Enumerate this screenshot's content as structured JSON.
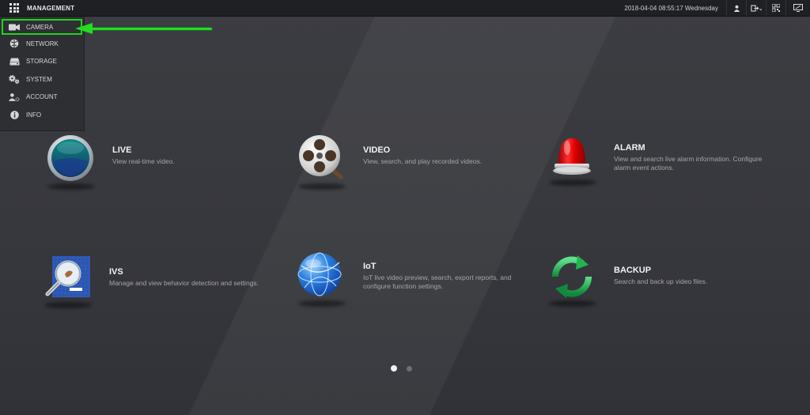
{
  "topbar": {
    "title": "MANAGEMENT",
    "datetime": "2018-04-04 08:55:17 Wednesday",
    "icons": [
      "grid-menu-icon",
      "user-icon",
      "logout-icon",
      "qr-code-icon",
      "monitor-icon"
    ]
  },
  "menu": {
    "items": [
      {
        "label": "CAMERA",
        "icon": "camera-icon",
        "active": true
      },
      {
        "label": "NETWORK",
        "icon": "network-icon"
      },
      {
        "label": "STORAGE",
        "icon": "storage-icon"
      },
      {
        "label": "SYSTEM",
        "icon": "system-gears-icon"
      },
      {
        "label": "ACCOUNT",
        "icon": "account-icon"
      },
      {
        "label": "INFO",
        "icon": "info-icon"
      }
    ]
  },
  "tiles": {
    "live": {
      "title": "LIVE",
      "desc": "View real-time video."
    },
    "video": {
      "title": "VIDEO",
      "desc": "View, search, and play recorded videos."
    },
    "alarm": {
      "title": "ALARM",
      "desc": "View and search live alarm information. Configure alarm event actions."
    },
    "ivs": {
      "title": "IVS",
      "desc": "Manage and view behavior detection and settings."
    },
    "iot": {
      "title": "IoT",
      "desc": "IoT live video preview, search, export reports, and configure function settings."
    },
    "backup": {
      "title": "BACKUP",
      "desc": "Search and back up video files."
    }
  },
  "pagination": {
    "current": 1,
    "total": 2
  },
  "colors": {
    "highlight": "#22dd22",
    "topbar": "#1f2023",
    "background": "#3a3b40"
  }
}
